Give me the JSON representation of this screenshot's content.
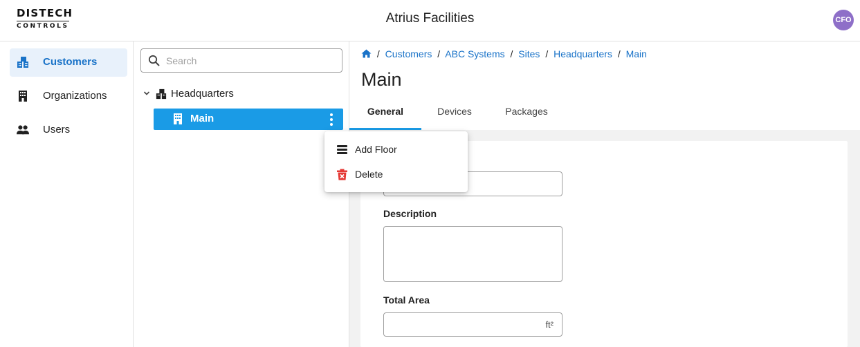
{
  "header": {
    "logo_line1": "DISTECH",
    "logo_line2": "CONTROLS",
    "title": "Atrius Facilities",
    "avatar_initials": "CFO",
    "avatar_color": "#8e6fc8"
  },
  "leftnav": {
    "items": [
      {
        "label": "Customers",
        "icon": "buildings-icon",
        "active": true
      },
      {
        "label": "Organizations",
        "icon": "building-icon",
        "active": false
      },
      {
        "label": "Users",
        "icon": "users-icon",
        "active": false
      }
    ]
  },
  "tree": {
    "search_placeholder": "Search",
    "root": {
      "label": "Headquarters",
      "expanded": true
    },
    "selected": {
      "label": "Main"
    }
  },
  "context_menu": {
    "items": [
      {
        "label": "Add Floor",
        "icon": "layers-icon"
      },
      {
        "label": "Delete",
        "icon": "trash-icon"
      }
    ]
  },
  "breadcrumb": {
    "items": [
      "Customers",
      "ABC Systems",
      "Sites",
      "Headquarters",
      "Main"
    ],
    "separator": "/"
  },
  "page": {
    "title": "Main",
    "tabs": [
      {
        "label": "General",
        "active": true
      },
      {
        "label": "Devices",
        "active": false
      },
      {
        "label": "Packages",
        "active": false
      }
    ]
  },
  "form": {
    "name_value": "",
    "description_label": "Description",
    "description_value": "",
    "total_area_label": "Total Area",
    "total_area_value": "",
    "total_area_unit": "ft²"
  },
  "colors": {
    "accent": "#1a9be6",
    "link": "#1a73c8",
    "active_nav_bg": "#e8f1fb",
    "delete_red": "#e53935"
  }
}
